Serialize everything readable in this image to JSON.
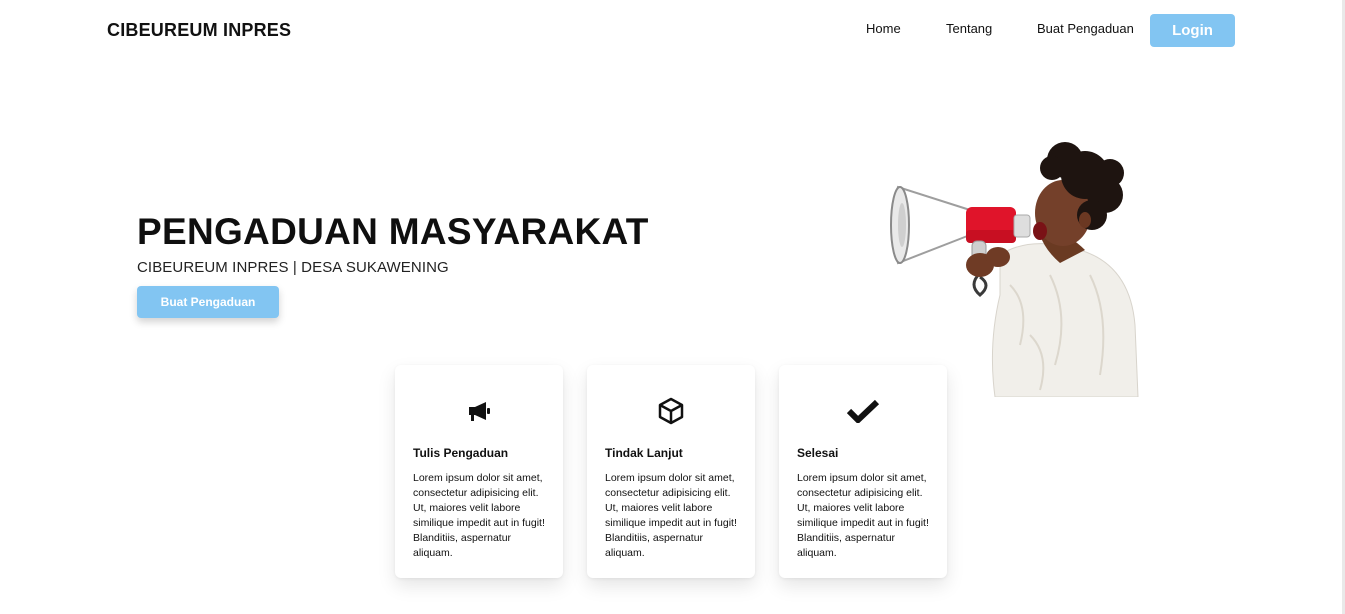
{
  "navbar": {
    "brand": "CIBEUREUM INPRES",
    "links": [
      "Home",
      "Tentang",
      "Buat Pengaduan"
    ],
    "login_label": "Login"
  },
  "hero": {
    "title": "PENGADUAN MASYARAKAT",
    "subtitle": "CIBEUREUM INPRES | DESA SUKAWENING",
    "button_label": "Buat Pengaduan",
    "image": "man-shouting-into-megaphone"
  },
  "cards": [
    {
      "icon": "megaphone-icon",
      "title": "Tulis Pengaduan",
      "text": "Lorem ipsum dolor sit amet, consectetur adipisicing elit. Ut, maiores velit labore similique impedit aut in fugit! Blanditiis, aspernatur aliquam."
    },
    {
      "icon": "box-icon",
      "title": "Tindak Lanjut",
      "text": "Lorem ipsum dolor sit amet, consectetur adipisicing elit. Ut, maiores velit labore similique impedit aut in fugit! Blanditiis, aspernatur aliquam."
    },
    {
      "icon": "check-icon",
      "title": "Selesai",
      "text": "Lorem ipsum dolor sit amet, consectetur adipisicing elit. Ut, maiores velit labore similique impedit aut in fugit! Blanditiis, aspernatur aliquam."
    }
  ],
  "colors": {
    "accent": "#82c5f2",
    "text": "#111111",
    "background": "#ffffff"
  }
}
